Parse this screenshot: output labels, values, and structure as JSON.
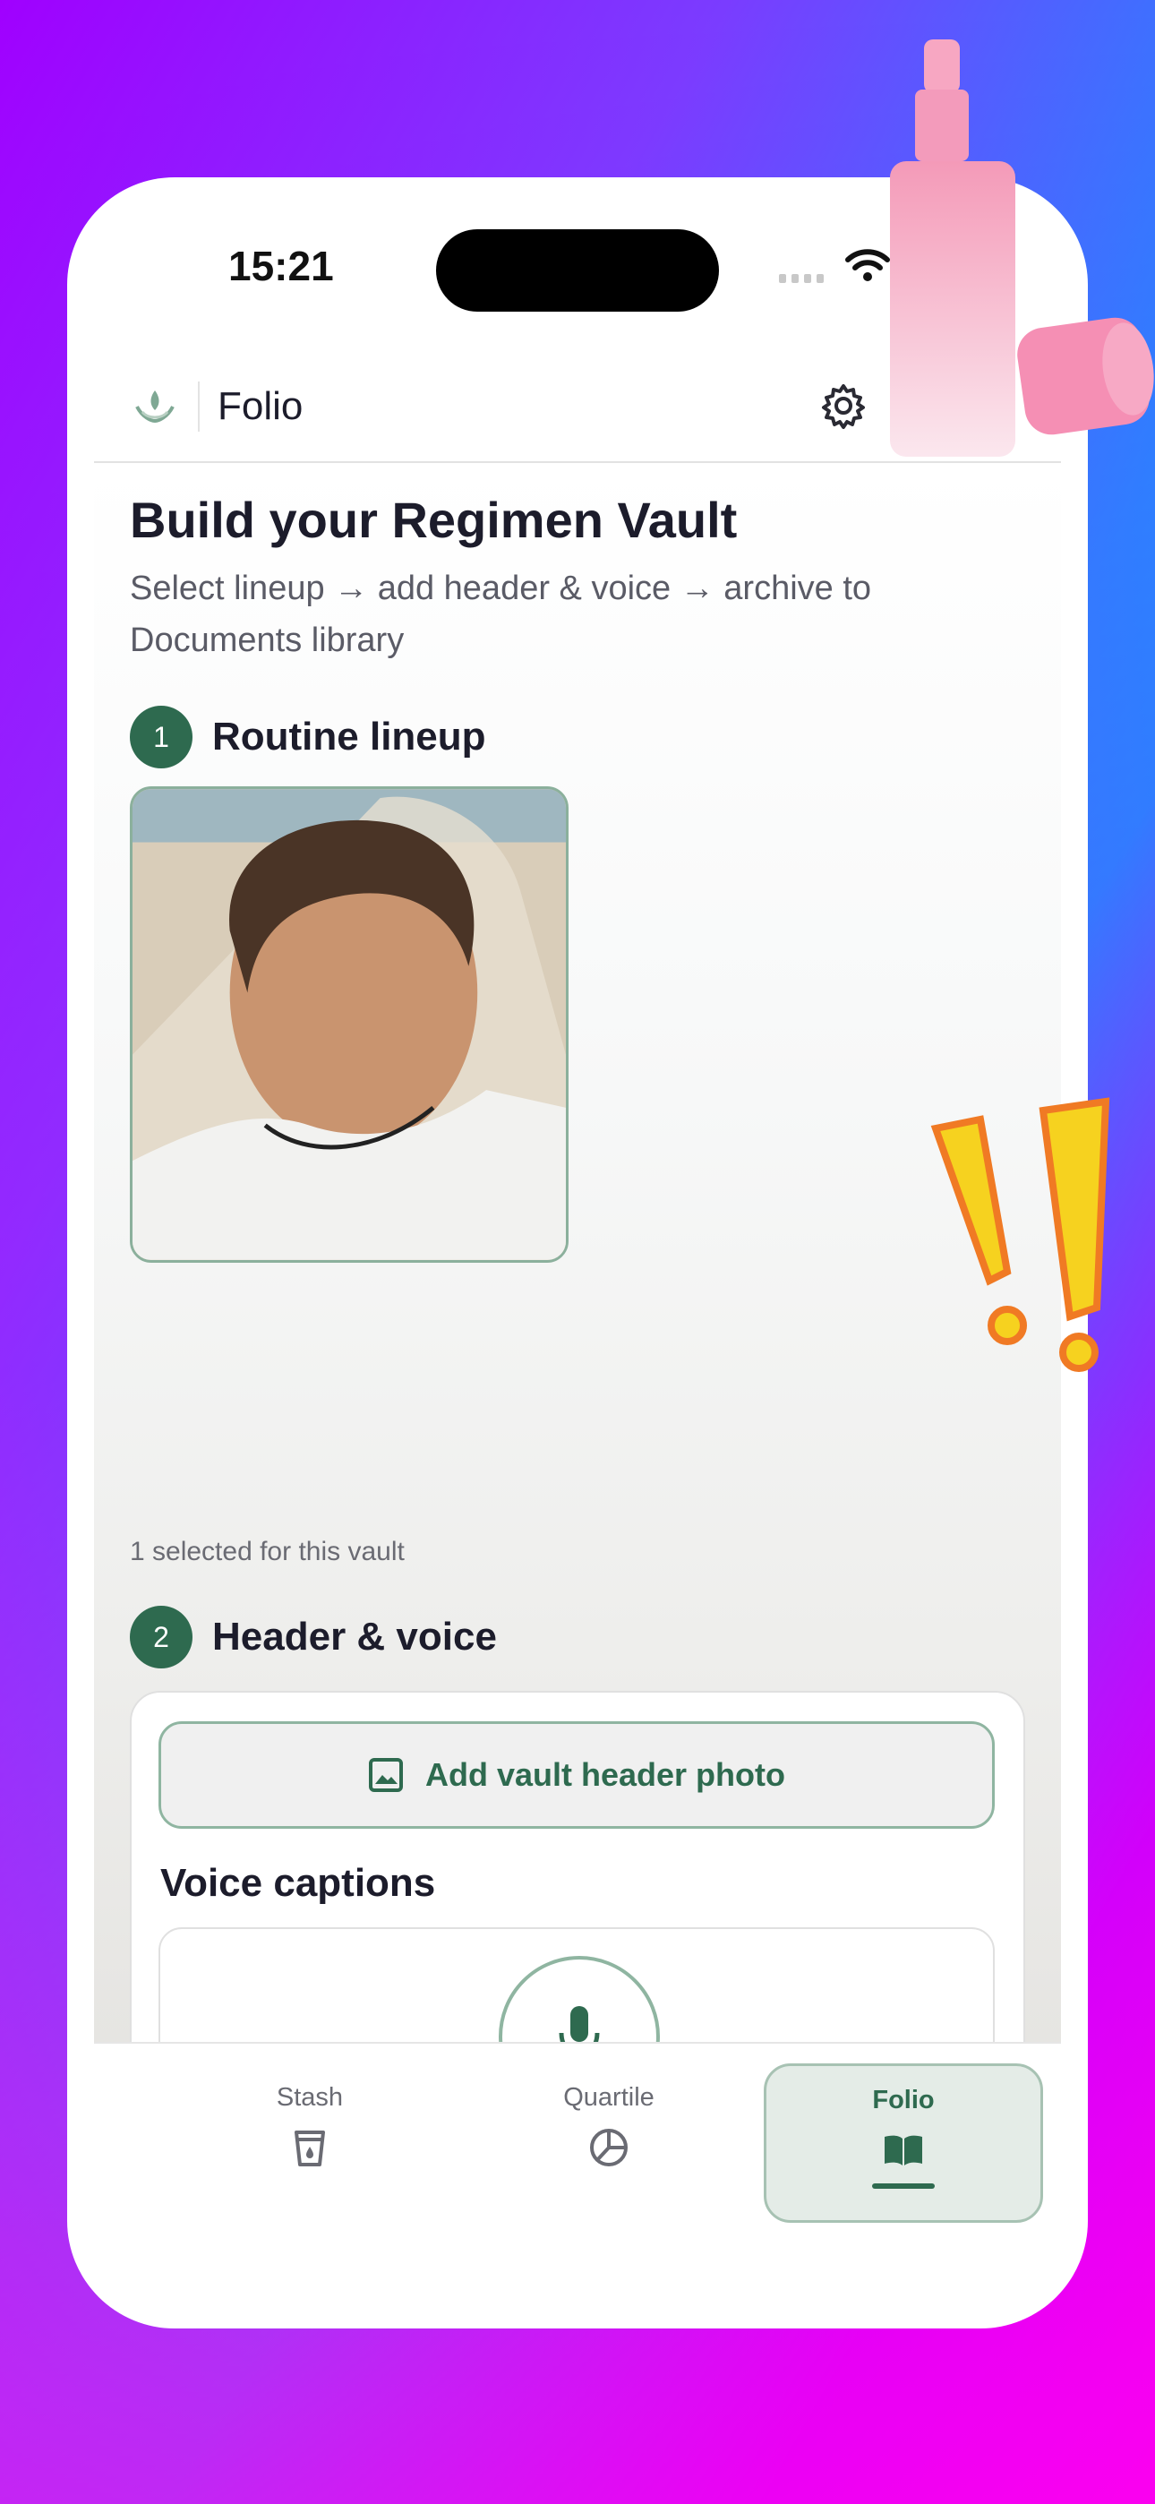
{
  "status": {
    "time": "15:21"
  },
  "appbar": {
    "title": "Folio"
  },
  "main": {
    "title": "Build your Regimen Vault",
    "subtitle": "Select lineup → add header & voice → archive to Documents library",
    "step1": {
      "number": "1",
      "label": "Routine lineup"
    },
    "selected_note": "1 selected for this vault",
    "step2": {
      "number": "2",
      "label": "Header & voice"
    },
    "add_photo_label": "Add vault header photo",
    "voice_title": "Voice captions"
  },
  "tabs": [
    {
      "label": "Stash",
      "icon": "cup-icon",
      "active": false
    },
    {
      "label": "Quartile",
      "icon": "pie-chart-icon",
      "active": false
    },
    {
      "label": "Folio",
      "icon": "book-icon",
      "active": true
    }
  ],
  "colors": {
    "accent": "#2e6a4f",
    "accent_light": "#e4ece7",
    "border": "#8fb5a1"
  }
}
